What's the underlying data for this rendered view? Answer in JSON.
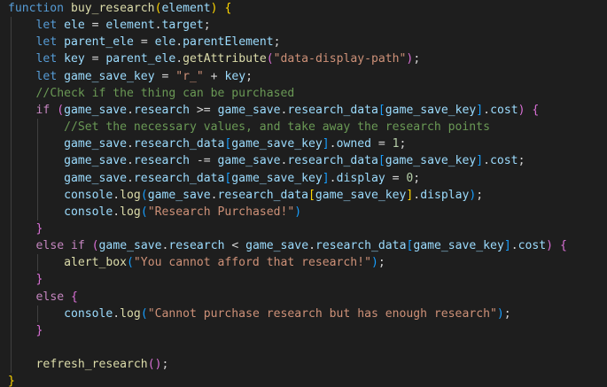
{
  "editor": {
    "language": "javascript",
    "theme": "dark",
    "lines": [
      [
        {
          "t": "function",
          "c": "kw"
        },
        {
          "t": " "
        },
        {
          "t": "buy_research",
          "c": "fn"
        },
        {
          "t": "(",
          "c": "b1"
        },
        {
          "t": "element",
          "c": "var"
        },
        {
          "t": ")",
          "c": "b1"
        },
        {
          "t": " "
        },
        {
          "t": "{",
          "c": "b1"
        }
      ],
      [
        {
          "t": "    "
        },
        {
          "t": "let",
          "c": "kw"
        },
        {
          "t": " "
        },
        {
          "t": "ele",
          "c": "var"
        },
        {
          "t": " = "
        },
        {
          "t": "element",
          "c": "var"
        },
        {
          "t": "."
        },
        {
          "t": "target",
          "c": "var"
        },
        {
          "t": ";"
        }
      ],
      [
        {
          "t": "    "
        },
        {
          "t": "let",
          "c": "kw"
        },
        {
          "t": " "
        },
        {
          "t": "parent_ele",
          "c": "var"
        },
        {
          "t": " = "
        },
        {
          "t": "ele",
          "c": "var"
        },
        {
          "t": "."
        },
        {
          "t": "parentElement",
          "c": "var"
        },
        {
          "t": ";"
        }
      ],
      [
        {
          "t": "    "
        },
        {
          "t": "let",
          "c": "kw"
        },
        {
          "t": " "
        },
        {
          "t": "key",
          "c": "var"
        },
        {
          "t": " = "
        },
        {
          "t": "parent_ele",
          "c": "var"
        },
        {
          "t": "."
        },
        {
          "t": "getAttribute",
          "c": "fn"
        },
        {
          "t": "(",
          "c": "b2"
        },
        {
          "t": "\"data-display-path\"",
          "c": "str"
        },
        {
          "t": ")",
          "c": "b2"
        },
        {
          "t": ";"
        }
      ],
      [
        {
          "t": "    "
        },
        {
          "t": "let",
          "c": "kw"
        },
        {
          "t": " "
        },
        {
          "t": "game_save_key",
          "c": "var"
        },
        {
          "t": " = "
        },
        {
          "t": "\"r_\"",
          "c": "str"
        },
        {
          "t": " + "
        },
        {
          "t": "key",
          "c": "var"
        },
        {
          "t": ";"
        }
      ],
      [
        {
          "t": "    "
        },
        {
          "t": "//Check if the thing can be purchased",
          "c": "cmt"
        }
      ],
      [
        {
          "t": "    "
        },
        {
          "t": "if",
          "c": "ctl"
        },
        {
          "t": " "
        },
        {
          "t": "(",
          "c": "b2"
        },
        {
          "t": "game_save",
          "c": "var"
        },
        {
          "t": "."
        },
        {
          "t": "research",
          "c": "var"
        },
        {
          "t": " >= "
        },
        {
          "t": "game_save",
          "c": "var"
        },
        {
          "t": "."
        },
        {
          "t": "research_data",
          "c": "var"
        },
        {
          "t": "[",
          "c": "b3"
        },
        {
          "t": "game_save_key",
          "c": "var"
        },
        {
          "t": "]",
          "c": "b3"
        },
        {
          "t": "."
        },
        {
          "t": "cost",
          "c": "var"
        },
        {
          "t": ")",
          "c": "b2"
        },
        {
          "t": " "
        },
        {
          "t": "{",
          "c": "b2"
        }
      ],
      [
        {
          "t": "        "
        },
        {
          "t": "//Set the necessary values, and take away the research points",
          "c": "cmt"
        }
      ],
      [
        {
          "t": "        "
        },
        {
          "t": "game_save",
          "c": "var"
        },
        {
          "t": "."
        },
        {
          "t": "research_data",
          "c": "var"
        },
        {
          "t": "[",
          "c": "b3"
        },
        {
          "t": "game_save_key",
          "c": "var"
        },
        {
          "t": "]",
          "c": "b3"
        },
        {
          "t": "."
        },
        {
          "t": "owned",
          "c": "var"
        },
        {
          "t": " = "
        },
        {
          "t": "1",
          "c": "num"
        },
        {
          "t": ";"
        }
      ],
      [
        {
          "t": "        "
        },
        {
          "t": "game_save",
          "c": "var"
        },
        {
          "t": "."
        },
        {
          "t": "research",
          "c": "var"
        },
        {
          "t": " -= "
        },
        {
          "t": "game_save",
          "c": "var"
        },
        {
          "t": "."
        },
        {
          "t": "research_data",
          "c": "var"
        },
        {
          "t": "[",
          "c": "b3"
        },
        {
          "t": "game_save_key",
          "c": "var"
        },
        {
          "t": "]",
          "c": "b3"
        },
        {
          "t": "."
        },
        {
          "t": "cost",
          "c": "var"
        },
        {
          "t": ";"
        }
      ],
      [
        {
          "t": "        "
        },
        {
          "t": "game_save",
          "c": "var"
        },
        {
          "t": "."
        },
        {
          "t": "research_data",
          "c": "var"
        },
        {
          "t": "[",
          "c": "b3"
        },
        {
          "t": "game_save_key",
          "c": "var"
        },
        {
          "t": "]",
          "c": "b3"
        },
        {
          "t": "."
        },
        {
          "t": "display",
          "c": "var"
        },
        {
          "t": " = "
        },
        {
          "t": "0",
          "c": "num"
        },
        {
          "t": ";"
        }
      ],
      [
        {
          "t": "        "
        },
        {
          "t": "console",
          "c": "var"
        },
        {
          "t": "."
        },
        {
          "t": "log",
          "c": "fn"
        },
        {
          "t": "(",
          "c": "b3"
        },
        {
          "t": "game_save",
          "c": "var"
        },
        {
          "t": "."
        },
        {
          "t": "research_data",
          "c": "var"
        },
        {
          "t": "[",
          "c": "b1"
        },
        {
          "t": "game_save_key",
          "c": "var"
        },
        {
          "t": "]",
          "c": "b1"
        },
        {
          "t": "."
        },
        {
          "t": "display",
          "c": "var"
        },
        {
          "t": ")",
          "c": "b3"
        },
        {
          "t": ";"
        }
      ],
      [
        {
          "t": "        "
        },
        {
          "t": "console",
          "c": "var"
        },
        {
          "t": "."
        },
        {
          "t": "log",
          "c": "fn"
        },
        {
          "t": "(",
          "c": "b3"
        },
        {
          "t": "\"Research Purchased!\"",
          "c": "str"
        },
        {
          "t": ")",
          "c": "b3"
        }
      ],
      [
        {
          "t": "    "
        },
        {
          "t": "}",
          "c": "b2"
        }
      ],
      [
        {
          "t": "    "
        },
        {
          "t": "else",
          "c": "ctl"
        },
        {
          "t": " "
        },
        {
          "t": "if",
          "c": "ctl"
        },
        {
          "t": " "
        },
        {
          "t": "(",
          "c": "b2"
        },
        {
          "t": "game_save",
          "c": "var"
        },
        {
          "t": "."
        },
        {
          "t": "research",
          "c": "var"
        },
        {
          "t": " < "
        },
        {
          "t": "game_save",
          "c": "var"
        },
        {
          "t": "."
        },
        {
          "t": "research_data",
          "c": "var"
        },
        {
          "t": "[",
          "c": "b3"
        },
        {
          "t": "game_save_key",
          "c": "var"
        },
        {
          "t": "]",
          "c": "b3"
        },
        {
          "t": "."
        },
        {
          "t": "cost",
          "c": "var"
        },
        {
          "t": ")",
          "c": "b2"
        },
        {
          "t": " "
        },
        {
          "t": "{",
          "c": "b2"
        }
      ],
      [
        {
          "t": "        "
        },
        {
          "t": "alert_box",
          "c": "fn"
        },
        {
          "t": "(",
          "c": "b3"
        },
        {
          "t": "\"You cannot afford that research!\"",
          "c": "str"
        },
        {
          "t": ")",
          "c": "b3"
        },
        {
          "t": ";"
        }
      ],
      [
        {
          "t": "    "
        },
        {
          "t": "}",
          "c": "b2"
        }
      ],
      [
        {
          "t": "    "
        },
        {
          "t": "else",
          "c": "ctl"
        },
        {
          "t": " "
        },
        {
          "t": "{",
          "c": "b2"
        }
      ],
      [
        {
          "t": "        "
        },
        {
          "t": "console",
          "c": "var"
        },
        {
          "t": "."
        },
        {
          "t": "log",
          "c": "fn"
        },
        {
          "t": "(",
          "c": "b3"
        },
        {
          "t": "\"Cannot purchase research but has enough research\"",
          "c": "str"
        },
        {
          "t": ")",
          "c": "b3"
        },
        {
          "t": ";"
        }
      ],
      [
        {
          "t": "    "
        },
        {
          "t": "}",
          "c": "b2"
        }
      ],
      [],
      [
        {
          "t": "    "
        },
        {
          "t": "refresh_research",
          "c": "fn"
        },
        {
          "t": "(",
          "c": "b2"
        },
        {
          "t": ")",
          "c": "b2"
        },
        {
          "t": ";"
        }
      ],
      [
        {
          "t": "}",
          "c": "b1"
        }
      ]
    ]
  }
}
